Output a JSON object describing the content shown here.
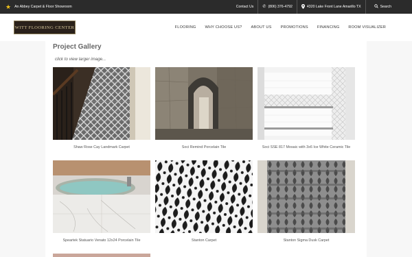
{
  "topbar": {
    "tagline": "An Abbey Carpet & Floor Showroom",
    "contact_label": "Contact Us",
    "phone": "(806) 376-4792",
    "address": "4320 Lake Front Lane Amarillo TX",
    "search_label": "Search"
  },
  "logo": {
    "text": "WITT FLOORING CENTER"
  },
  "nav": {
    "items": [
      "FLOORING",
      "WHY CHOOSE US?",
      "ABOUT US",
      "PROMOTIONS",
      "FINANCING",
      "ROOM VISUALIZER"
    ]
  },
  "gallery": {
    "title": "Project Gallery",
    "subtitle": "click to view larger image...",
    "items": [
      {
        "caption": "Shaw Rose Cay Landmark Carpet"
      },
      {
        "caption": "Soci Remind Porcelain Tile"
      },
      {
        "caption": "Soci SSE 817 Mosaic with 3x6 Ice White Ceramic Tile"
      },
      {
        "caption": "Speartek Statuario Venato 12x24 Porcelain Tile"
      },
      {
        "caption": "Stanton Carpet"
      },
      {
        "caption": "Stanton Sigma Dusk Carpet"
      }
    ]
  },
  "colors": {
    "topbar_bg": "#2b2b2b",
    "star": "#f2c21a",
    "page_bg": "#f7f7f7"
  }
}
